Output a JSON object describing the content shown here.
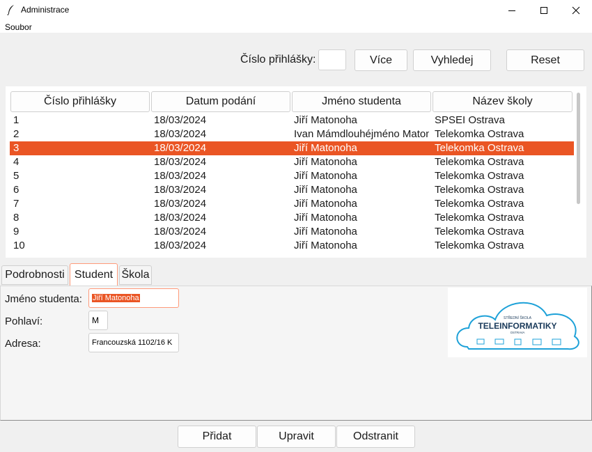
{
  "window": {
    "title": "Administrace",
    "icon": "feather-icon",
    "controls": [
      "minimize-icon",
      "maximize-icon",
      "close-icon"
    ]
  },
  "menu": {
    "items": [
      "Soubor"
    ]
  },
  "search": {
    "label": "Číslo přihlášky:",
    "value": "",
    "buttons": {
      "more": "Více",
      "search": "Vyhledej",
      "reset": "Reset"
    }
  },
  "table": {
    "columns": [
      "Číslo přihlášky",
      "Datum podání",
      "Jméno studenta",
      "Název školy"
    ],
    "selected_row": 2,
    "rows": [
      [
        "1",
        "18/03/2024",
        "Jiří Matonoha",
        "SPSEI Ostrava"
      ],
      [
        "2",
        "18/03/2024",
        "Ivan Mámdlouhéjméno Matonoha",
        "Telekomka Ostrava"
      ],
      [
        "3",
        "18/03/2024",
        "Jiří Matonoha",
        "Telekomka Ostrava"
      ],
      [
        "4",
        "18/03/2024",
        "Jiří Matonoha",
        "Telekomka Ostrava"
      ],
      [
        "5",
        "18/03/2024",
        "Jiří Matonoha",
        "Telekomka Ostrava"
      ],
      [
        "6",
        "18/03/2024",
        "Jiří Matonoha",
        "Telekomka Ostrava"
      ],
      [
        "7",
        "18/03/2024",
        "Jiří Matonoha",
        "Telekomka Ostrava"
      ],
      [
        "8",
        "18/03/2024",
        "Jiří Matonoha",
        "Telekomka Ostrava"
      ],
      [
        "9",
        "18/03/2024",
        "Jiří Matonoha",
        "Telekomka Ostrava"
      ],
      [
        "10",
        "18/03/2024",
        "Jiří Matonoha",
        "Telekomka Ostrava"
      ]
    ]
  },
  "tabs": [
    {
      "label": "Podrobnosti",
      "active": false
    },
    {
      "label": "Student",
      "active": true
    },
    {
      "label": "Škola",
      "active": false
    }
  ],
  "student": {
    "name_label": "Jméno studenta:",
    "name_value": "Jiří Matonoha",
    "gender_label": "Pohlaví:",
    "gender_value": "M",
    "address_label": "Adresa:",
    "address_value": "Francouzská 1102/16 K"
  },
  "logo": {
    "line1": "STŘEDNÍ ŠKOLA",
    "line2": "TELEINFORMATIKY",
    "line3": "OSTRAVA",
    "color": "#1da1d8"
  },
  "actions": {
    "add": "Přidat",
    "edit": "Upravit",
    "remove": "Odstranit"
  },
  "colors": {
    "accent": "#ea5524",
    "focus_border": "#ff9a7a"
  }
}
